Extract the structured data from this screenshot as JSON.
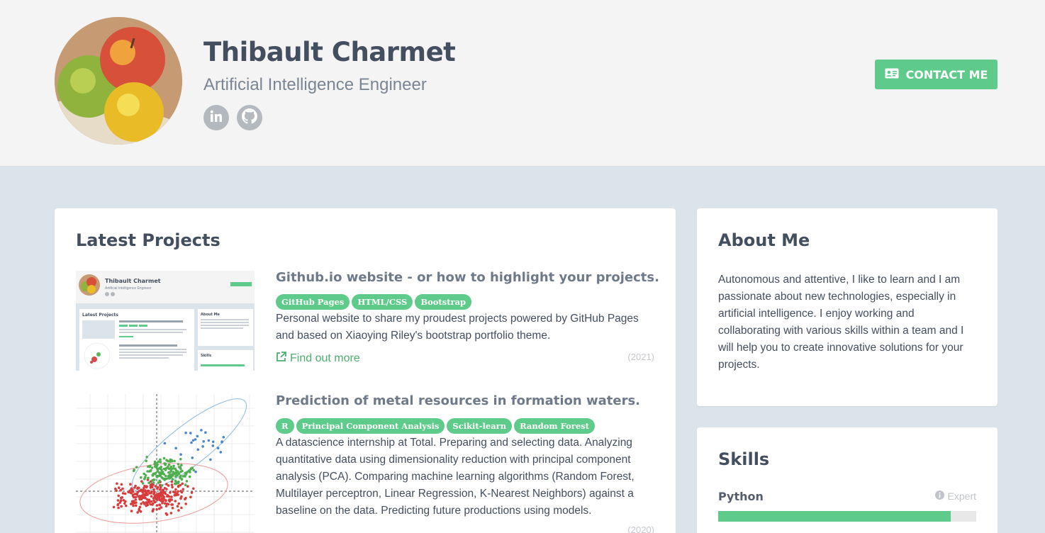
{
  "header": {
    "name": "Thibault Charmet",
    "tagline": "Artificial Intelligence Engineer",
    "social": [
      "linkedin-icon",
      "github-icon"
    ],
    "contact_label": "CONTACT ME"
  },
  "projects": {
    "title": "Latest Projects",
    "items": [
      {
        "title": "Github.io website - or how to highlight your projects.",
        "tags": [
          "GitHub Pages",
          "HTML/CSS",
          "Bootstrap"
        ],
        "description": "Personal website to share my proudest projects powered by GitHub Pages and based on Xiaoying Riley's bootstrap portfolio theme.",
        "link_label": "Find out more",
        "year": "(2021)"
      },
      {
        "title": "Prediction of metal resources in formation waters.",
        "tags": [
          "R",
          "Principal Component Analysis",
          "Scikit-learn",
          "Random Forest"
        ],
        "description": "A datascience internship at Total. Preparing and selecting data. Analyzing quantitative data using dimensionality reduction with principal component analysis (PCA). Comparing machine learning algorithms (Random Forest, Multilayer perceptron, Linear Regression, K-Nearest Neighbors) against a baseline on the data. Predicting future productions using models.",
        "year": "(2020)"
      }
    ]
  },
  "about": {
    "title": "About Me",
    "text": "Autonomous and attentive, I like to learn and I am passionate about new technologies, especially in artificial intelligence. I enjoy working and collaborating with various skills within a team and I will help you to create innovative solutions for your projects."
  },
  "skills": {
    "title": "Skills",
    "items": [
      {
        "name": "Python",
        "level": "Expert",
        "fill_percent": 90
      }
    ]
  },
  "colors": {
    "accent": "#5fcb8a",
    "header_bg": "#f4f4f4",
    "page_bg": "#dbe4eb",
    "heading": "#434e5e"
  }
}
